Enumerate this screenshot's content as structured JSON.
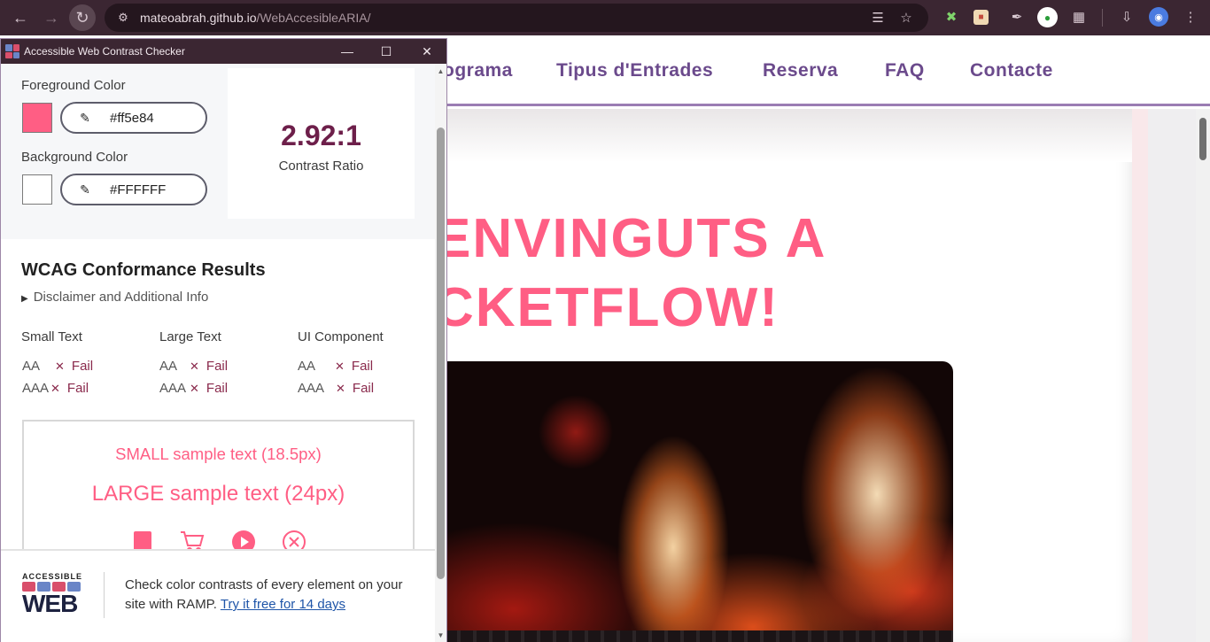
{
  "browser": {
    "url_host": "mateoabrah.github.io",
    "url_path": "/WebAccesibleARIA/"
  },
  "site": {
    "nav": [
      "ograma",
      "Tipus d'Entrades",
      "Reserva",
      "FAQ",
      "Contacte"
    ],
    "headline_line1": "ENVINGUTS A",
    "headline_line2": "CKETFLOW!"
  },
  "extension": {
    "title": "Accessible Web Contrast Checker",
    "foreground_label": "Foreground Color",
    "foreground_hex": "#ff5e84",
    "foreground_color": "#ff5e84",
    "background_label": "Background Color",
    "background_hex": "#FFFFFF",
    "background_color": "#FFFFFF",
    "ratio": "2.92:1",
    "ratio_label": "Contrast Ratio",
    "wcag_title": "WCAG Conformance Results",
    "disclaimer": "Disclaimer and Additional Info",
    "columns": [
      {
        "head": "Small Text",
        "rows": [
          {
            "level": "AA",
            "status": "Fail"
          },
          {
            "level": "AAA",
            "status": "Fail"
          }
        ]
      },
      {
        "head": "Large Text",
        "rows": [
          {
            "level": "AA",
            "status": "Fail"
          },
          {
            "level": "AAA",
            "status": "Fail"
          }
        ]
      },
      {
        "head": "UI Component",
        "rows": [
          {
            "level": "AA",
            "status": "Fail"
          },
          {
            "level": "AAA",
            "status": "Fail"
          }
        ]
      }
    ],
    "sample_small": "SMALL sample text (18.5px)",
    "sample_large": "LARGE sample text (24px)",
    "promo_logo_top": "ACCESSIBLE",
    "promo_logo_main": "WEB",
    "promo_text": "Check color contrasts of every element on your site with RAMP.",
    "promo_link": "Try it free for 14 days"
  },
  "colors": {
    "accent_pink": "#ff5e84",
    "ratio_color": "#6d1f4a",
    "fail_color": "#8a2a4c",
    "nav_color": "#6b4a8c"
  }
}
